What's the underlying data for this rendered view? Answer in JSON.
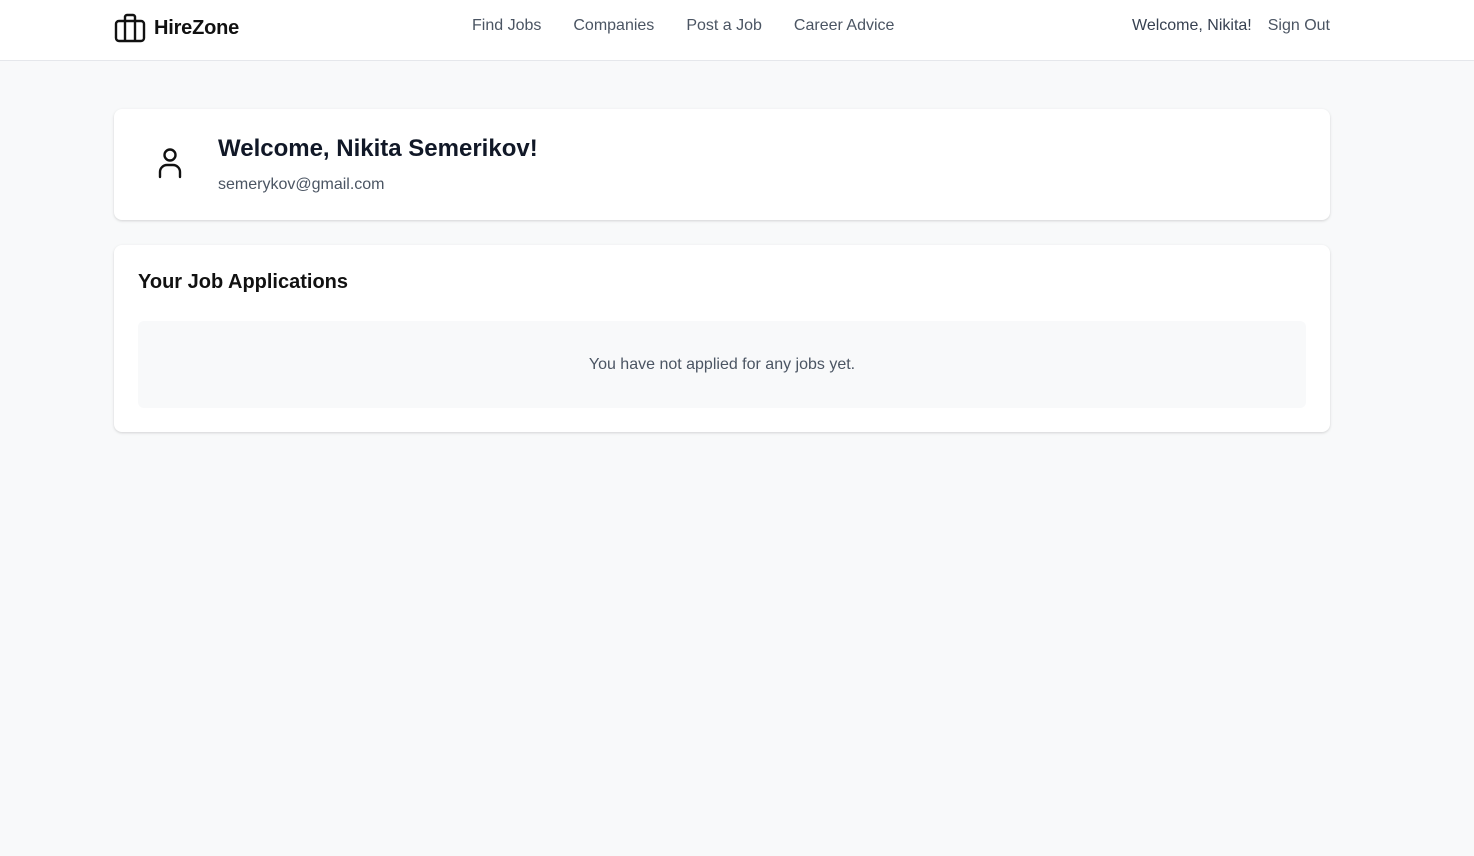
{
  "brand": {
    "name": "HireZone",
    "icon": "briefcase-icon"
  },
  "nav": {
    "links": [
      {
        "label": "Find Jobs"
      },
      {
        "label": "Companies"
      },
      {
        "label": "Post a Job"
      },
      {
        "label": "Career Advice"
      }
    ],
    "welcome": "Welcome, Nikita!",
    "sign_out": "Sign Out"
  },
  "profile": {
    "avatar_icon": "user-icon",
    "title": "Welcome, Nikita Semerikov!",
    "email": "semerykov@gmail.com"
  },
  "applications": {
    "title": "Your Job Applications",
    "empty_message": "You have not applied for any jobs yet."
  },
  "colors": {
    "page_background": "#f8f9fa",
    "card_background": "#ffffff",
    "muted_text": "#4b5563",
    "heading_text": "#111827"
  }
}
